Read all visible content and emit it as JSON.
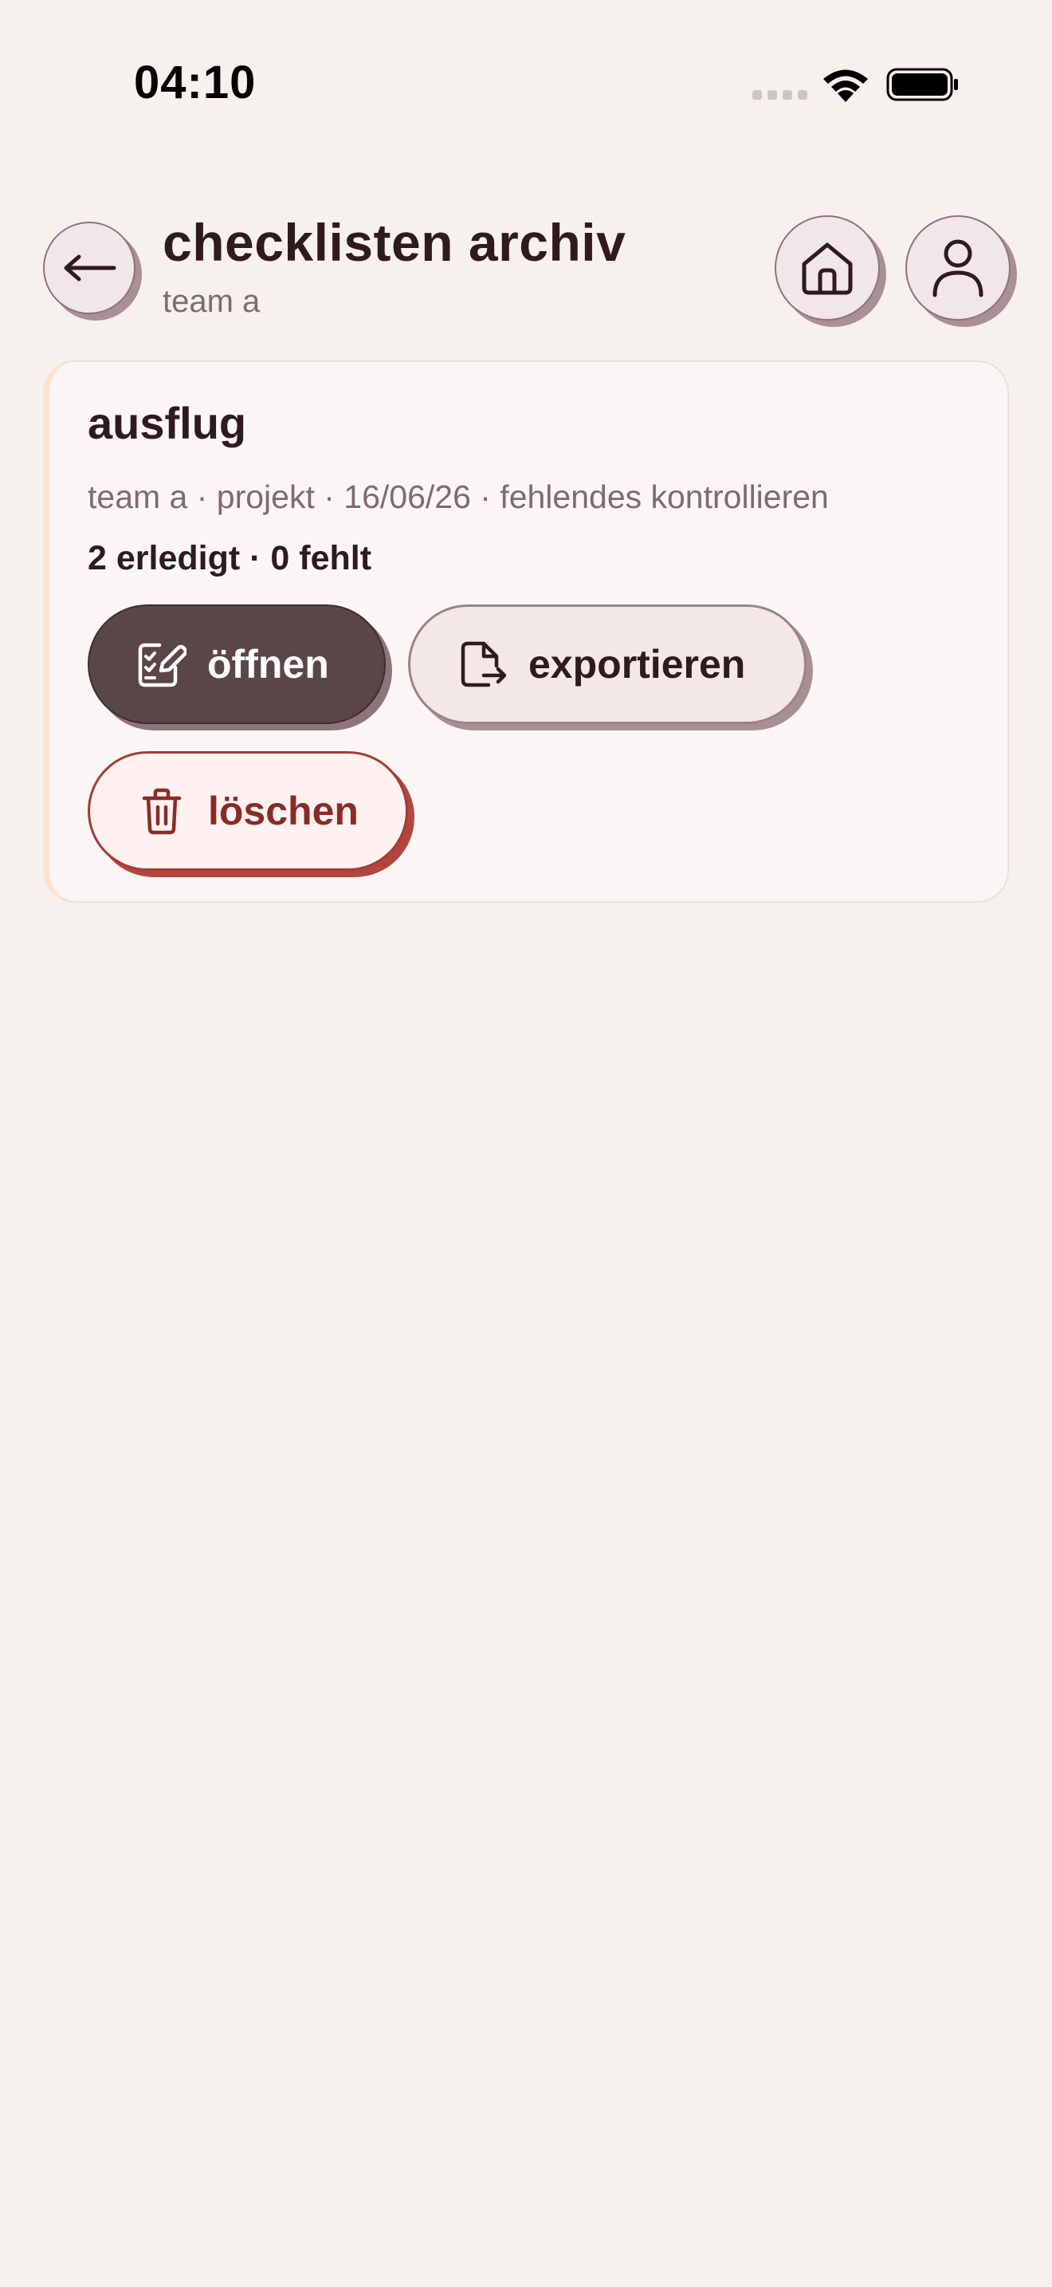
{
  "status_bar": {
    "time": "04:10",
    "icons": [
      "cellular-signal-icon",
      "wifi-icon",
      "battery-icon"
    ]
  },
  "header": {
    "title": "checklisten archiv",
    "subtitle": "team a",
    "icons": {
      "back": "arrow-left-icon",
      "home": "home-icon",
      "profile": "user-icon"
    }
  },
  "checklist": {
    "title": "ausflug",
    "meta": "team a · projekt · 16/06/26 · fehlendes kontrollieren",
    "progress": "2 erledigt · 0 fehlt",
    "actions": {
      "open_label": "öffnen",
      "open_icon": "edit-checklist-icon",
      "export_label": "exportieren",
      "export_icon": "file-export-icon",
      "delete_label": "löschen",
      "delete_icon": "trash-icon"
    }
  },
  "colors": {
    "background": "#f7f1ee",
    "text_primary": "#2f1a1d",
    "text_secondary": "#7f6a6d",
    "primary_button": "#5a4547",
    "secondary_button": "#f3e8e6",
    "danger": "#8a2b26",
    "danger_background": "#fff1f0",
    "card_accent": "#fbe3cf"
  }
}
